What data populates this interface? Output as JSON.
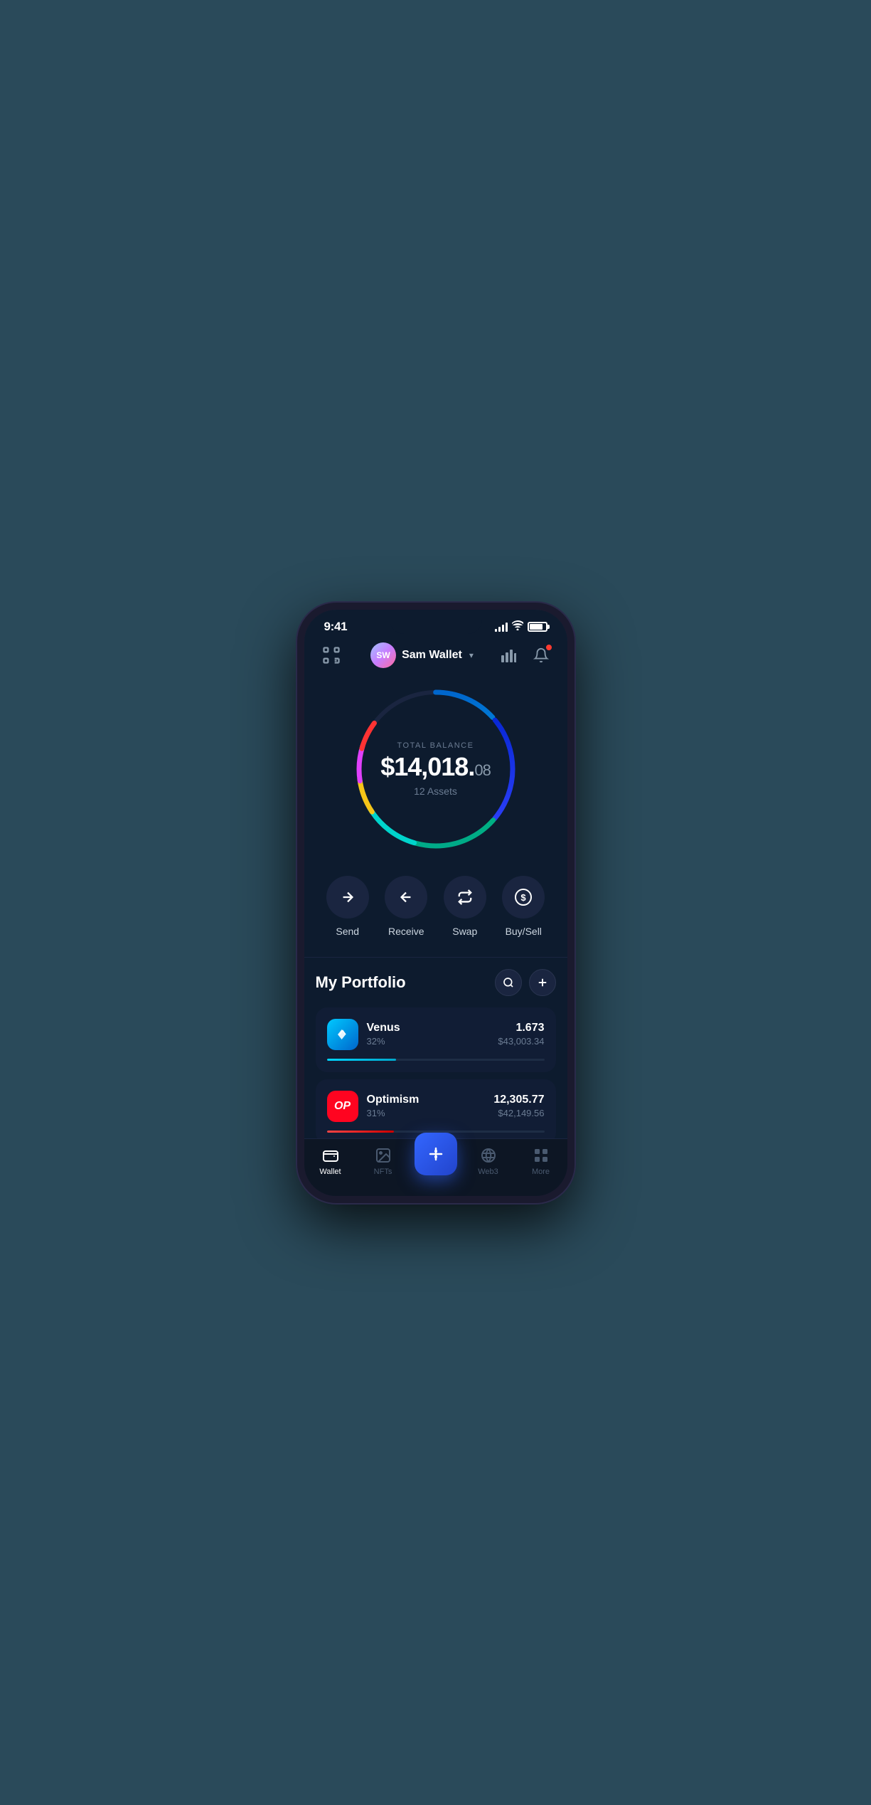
{
  "status": {
    "time": "9:41",
    "signal_bars": [
      4,
      7,
      10,
      13
    ],
    "battery_level": 85
  },
  "header": {
    "scanner_label": "scanner",
    "user_initials": "SW",
    "user_name": "Sam Wallet",
    "chevron": "▾",
    "chart_label": "chart",
    "bell_label": "bell"
  },
  "balance": {
    "label": "TOTAL BALANCE",
    "whole": "$14,018.",
    "cents": "08",
    "assets_label": "12 Assets"
  },
  "actions": [
    {
      "id": "send",
      "label": "Send",
      "icon": "→"
    },
    {
      "id": "receive",
      "label": "Receive",
      "icon": "←"
    },
    {
      "id": "swap",
      "label": "Swap",
      "icon": "⇅"
    },
    {
      "id": "buysell",
      "label": "Buy/Sell",
      "icon": "$"
    }
  ],
  "portfolio": {
    "title": "My Portfolio",
    "search_label": "search",
    "add_label": "add"
  },
  "assets": [
    {
      "id": "venus",
      "name": "Venus",
      "percent": "32%",
      "amount": "1.673",
      "value": "$43,003.34",
      "progress": 32,
      "color": "#00d4ff"
    },
    {
      "id": "optimism",
      "name": "Optimism",
      "percent": "31%",
      "amount": "12,305.77",
      "value": "$42,149.56",
      "progress": 31,
      "color": "#ff4444"
    }
  ],
  "nav": {
    "items": [
      {
        "id": "wallet",
        "label": "Wallet",
        "active": true
      },
      {
        "id": "nfts",
        "label": "NFTs",
        "active": false
      },
      {
        "id": "center",
        "label": "",
        "active": false
      },
      {
        "id": "web3",
        "label": "Web3",
        "active": false
      },
      {
        "id": "more",
        "label": "More",
        "active": false
      }
    ]
  }
}
